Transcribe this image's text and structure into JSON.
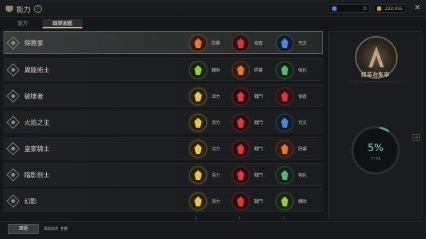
{
  "header": {
    "title": "能力",
    "help": "?",
    "currency1_value": "0",
    "currency2_value": "222,455",
    "close": "✕"
  },
  "tabs": [
    "能力",
    "職業圖鑑"
  ],
  "rows": [
    {
      "name": "探險家",
      "traits": [
        {
          "label": "防禦",
          "icon": "defense-icon"
        },
        {
          "label": "偵查",
          "icon": "scout-icon"
        },
        {
          "label": "咒文",
          "icon": "spell-icon"
        }
      ]
    },
    {
      "name": "異能術士",
      "traits": [
        {
          "label": "輔助",
          "icon": "support-icon"
        },
        {
          "label": "防禦",
          "icon": "defense-icon"
        },
        {
          "label": "強化",
          "icon": "boost-icon"
        }
      ]
    },
    {
      "name": "破壞者",
      "traits": [
        {
          "label": "活力",
          "icon": "vitality-icon"
        },
        {
          "label": "戰鬥",
          "icon": "combat-icon"
        },
        {
          "label": "偵查",
          "icon": "scout-icon"
        }
      ]
    },
    {
      "name": "火焰之主",
      "traits": [
        {
          "label": "活力",
          "icon": "vitality-icon"
        },
        {
          "label": "戰鬥",
          "icon": "combat-icon"
        },
        {
          "label": "咒文",
          "icon": "spell-icon"
        }
      ]
    },
    {
      "name": "皇家騎士",
      "traits": [
        {
          "label": "活力",
          "icon": "vitality-icon"
        },
        {
          "label": "戰鬥",
          "icon": "combat-icon"
        },
        {
          "label": "防禦",
          "icon": "defense-icon"
        }
      ]
    },
    {
      "name": "暗影劍士",
      "traits": [
        {
          "label": "活力",
          "icon": "vitality-icon"
        },
        {
          "label": "戰鬥",
          "icon": "combat-icon"
        },
        {
          "label": "強化",
          "icon": "boost-icon"
        }
      ]
    },
    {
      "name": "幻影",
      "traits": [
        {
          "label": "活力",
          "icon": "vitality-icon"
        },
        {
          "label": "戰鬥",
          "icon": "combat-icon"
        },
        {
          "label": "輔助",
          "icon": "support-icon"
        }
      ]
    }
  ],
  "counts": [
    "6",
    "4",
    "3"
  ],
  "side": {
    "title": "職業收集率",
    "percent": "5%",
    "collected": "3 / 61",
    "arrow": "→"
  },
  "footer": {
    "filter_button": "篩選",
    "filter_label": "職業篩選",
    "filter_value": "全部"
  },
  "colors": {
    "accent": "#7fd1c8",
    "tab_underline": "#c9b98f"
  }
}
